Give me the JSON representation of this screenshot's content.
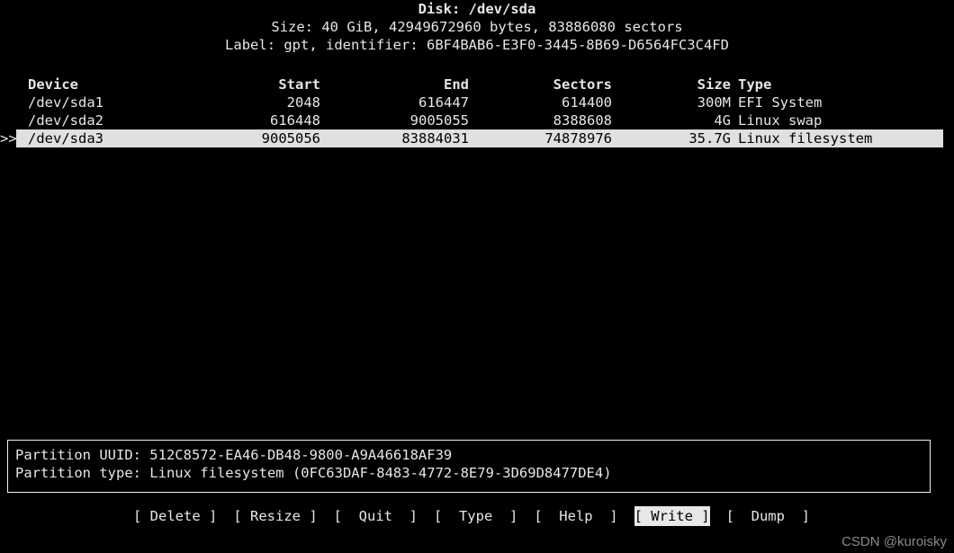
{
  "header": {
    "disk_line": "Disk: /dev/sda",
    "size_line": "Size: 40 GiB, 42949672960 bytes, 83886080 sectors",
    "label_line": "Label: gpt, identifier: 6BF4BAB6-E3F0-3445-8B69-D6564FC3C4FD"
  },
  "table": {
    "columns": {
      "device": "Device",
      "start": "Start",
      "end": "End",
      "sectors": "Sectors",
      "size": "Size",
      "type": "Type"
    },
    "rows": [
      {
        "marker": "",
        "device": "/dev/sda1",
        "start": "2048",
        "end": "616447",
        "sectors": "614400",
        "size": "300M",
        "type": "EFI System",
        "selected": false
      },
      {
        "marker": "",
        "device": "/dev/sda2",
        "start": "616448",
        "end": "9005055",
        "sectors": "8388608",
        "size": "4G",
        "type": "Linux swap",
        "selected": false
      },
      {
        "marker": ">>",
        "device": "/dev/sda3",
        "start": "9005056",
        "end": "83884031",
        "sectors": "74878976",
        "size": "35.7G",
        "type": "Linux filesystem",
        "selected": true
      }
    ]
  },
  "info": {
    "uuid_line": "Partition UUID: 512C8572-EA46-DB48-9800-A9A46618AF39",
    "type_line": "Partition type: Linux filesystem (0FC63DAF-8483-4772-8E79-3D69D8477DE4)"
  },
  "menu": {
    "items": [
      {
        "label": "Delete",
        "text": "[ Delete ]",
        "active": false
      },
      {
        "label": "Resize",
        "text": "[ Resize ]",
        "active": false
      },
      {
        "label": "Quit",
        "text": "[  Quit  ]",
        "active": false
      },
      {
        "label": "Type",
        "text": "[  Type  ]",
        "active": false
      },
      {
        "label": "Help",
        "text": "[  Help  ]",
        "active": false
      },
      {
        "label": "Write",
        "text": "[ Write ]",
        "active": true
      },
      {
        "label": "Dump",
        "text": "[  Dump  ]",
        "active": false
      }
    ]
  },
  "watermark": {
    "text": "CSDN @kuroisky"
  },
  "colors": {
    "background": "#000000",
    "foreground": "#e6e6e6",
    "highlight_bg": "#e0e0e0",
    "highlight_fg": "#000000",
    "border": "#f0f0f0",
    "watermark": "#8a8a8a"
  }
}
